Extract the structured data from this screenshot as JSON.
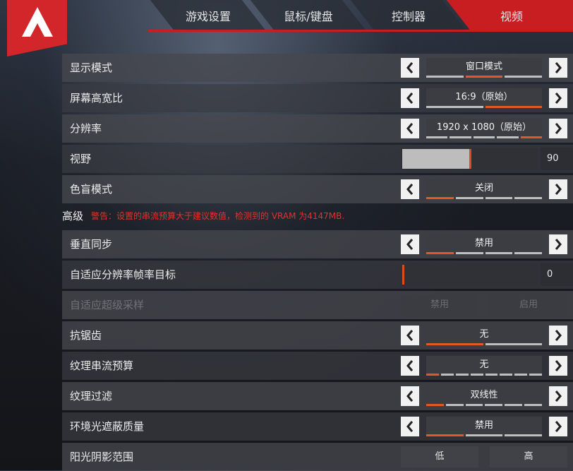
{
  "tabs": [
    {
      "label": "游戏设置",
      "active": false
    },
    {
      "label": "鼠标/键盘",
      "active": false
    },
    {
      "label": "控制器",
      "active": false
    },
    {
      "label": "视频",
      "active": true
    }
  ],
  "colors": {
    "accent": "#c81e22",
    "segment_on": "#e25a23",
    "warning": "#e3322c"
  },
  "settings": {
    "display_mode": {
      "label": "显示模式",
      "value": "窗口模式",
      "segments": 3,
      "selected": 1
    },
    "aspect_ratio": {
      "label": "屏幕高宽比",
      "value": "16:9（原始）",
      "segments": 2,
      "selected": 1
    },
    "resolution": {
      "label": "分辨率",
      "value": "1920 x 1080（原始）",
      "segments": 5,
      "selected": 4
    },
    "fov": {
      "label": "视野",
      "value": "90",
      "level": 0.5
    },
    "colorblind": {
      "label": "色盲模式",
      "value": "关闭",
      "segments": 4,
      "selected": 0
    }
  },
  "advanced": {
    "title": "高级",
    "warning": "警告：设置的串流预算大于建议数值，检测到的 VRAM 为4147MB.",
    "vsync": {
      "label": "垂直同步",
      "value": "禁用",
      "segments": 4,
      "selected": 0
    },
    "adaptive_res": {
      "label": "自适应分辨率帧率目标",
      "value": "0",
      "level": 0.0
    },
    "adaptive_supersample": {
      "label": "自适应超级采样",
      "option_a": "禁用",
      "option_b": "启用",
      "disabled": true
    },
    "antialiasing": {
      "label": "抗锯齿",
      "value": "无",
      "segments": 2,
      "selected": 0
    },
    "texture_budget": {
      "label": "纹理串流预算",
      "value": "无",
      "segments": 8,
      "selected": 0
    },
    "texture_filter": {
      "label": "纹理过滤",
      "value": "双线性",
      "segments": 6,
      "selected": 0
    },
    "ambient_occlusion": {
      "label": "环境光遮蔽质量",
      "value": "禁用",
      "segments": 3,
      "selected": 0
    },
    "sun_shadow": {
      "label": "阳光阴影范围",
      "option_a": "低",
      "option_b": "高"
    }
  }
}
